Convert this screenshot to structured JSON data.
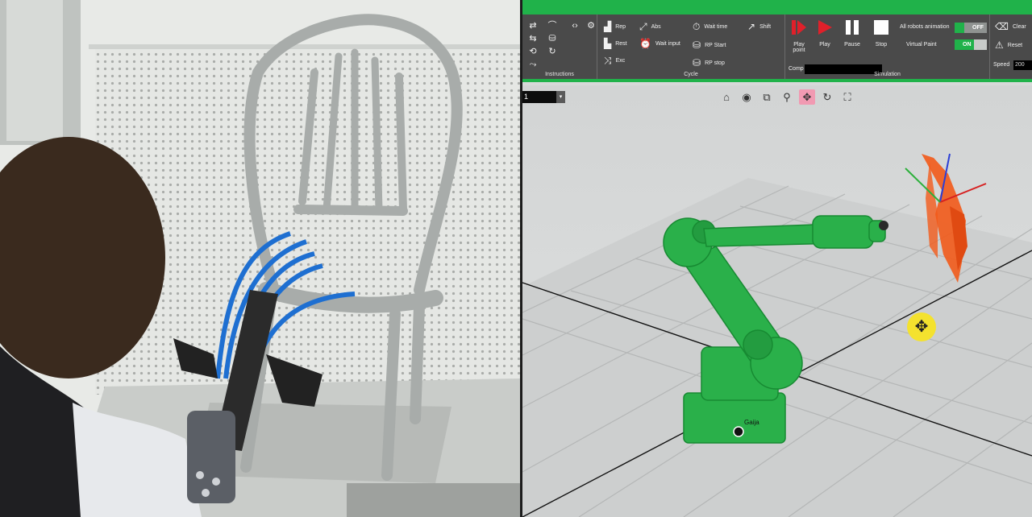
{
  "ribbon": {
    "instructions": {
      "label": "Instructions",
      "icons": [
        "loop-icon",
        "arc-move-icon",
        "code-icon",
        "gear-icon",
        "database-icon",
        "repeat-icon",
        "refresh-icon",
        "path-icon"
      ],
      "commands": [
        {
          "label": "Rep",
          "icon": "step-icon"
        },
        {
          "label": "Abs",
          "icon": "move-absolute-icon"
        },
        {
          "label": "Rest",
          "icon": "rest-icon"
        },
        {
          "label": "Wait input",
          "icon": "wait-input-icon"
        },
        {
          "label": "Exc",
          "icon": "exclusion-icon"
        }
      ]
    },
    "cycle": {
      "label": "Cycle",
      "items": [
        {
          "label": "Wait time",
          "icon": "timer-icon"
        },
        {
          "label": "Shift",
          "icon": "shift-icon"
        },
        {
          "label": "RP Start",
          "icon": "database-icon"
        },
        {
          "label": "RP stop",
          "icon": "database-stop-icon"
        }
      ]
    },
    "simulation": {
      "label": "Simulation",
      "buttons": [
        {
          "label": "Play point",
          "color": "#e0202a"
        },
        {
          "label": "Play",
          "color": "#e0202a"
        },
        {
          "label": "Pause",
          "color": "#ffffff"
        },
        {
          "label": "Stop",
          "color": "#ffffff"
        }
      ],
      "all_robots_animation": {
        "label": "All robots animation",
        "value": "OFF"
      },
      "virtual_paint": {
        "label": "Virtual Paint",
        "value": "ON"
      },
      "comp": {
        "label": "Comp",
        "value": ""
      }
    },
    "tools": {
      "clear_label": "Clear",
      "reset_label": "Reset",
      "speed": {
        "label": "Speed",
        "value": "200"
      }
    }
  },
  "viewport": {
    "selector_value": "1",
    "toolbar": [
      {
        "name": "home-icon",
        "glyph": "⌂"
      },
      {
        "name": "focus-icon",
        "glyph": "◉"
      },
      {
        "name": "zoom-region-icon",
        "glyph": "⧉"
      },
      {
        "name": "zoom-icon",
        "glyph": "⚲"
      },
      {
        "name": "pan-icon",
        "glyph": "✥"
      },
      {
        "name": "rotate-icon",
        "glyph": "↻"
      },
      {
        "name": "fit-view-icon",
        "glyph": "⛶"
      }
    ],
    "robot_brand": "Gaija",
    "cursor_glyph": "✥"
  },
  "colors": {
    "accent": "#20b24a",
    "robot": "#2ab04a",
    "toolpath": "#f25a1a",
    "ribbon_bg": "#4a4a4a"
  }
}
